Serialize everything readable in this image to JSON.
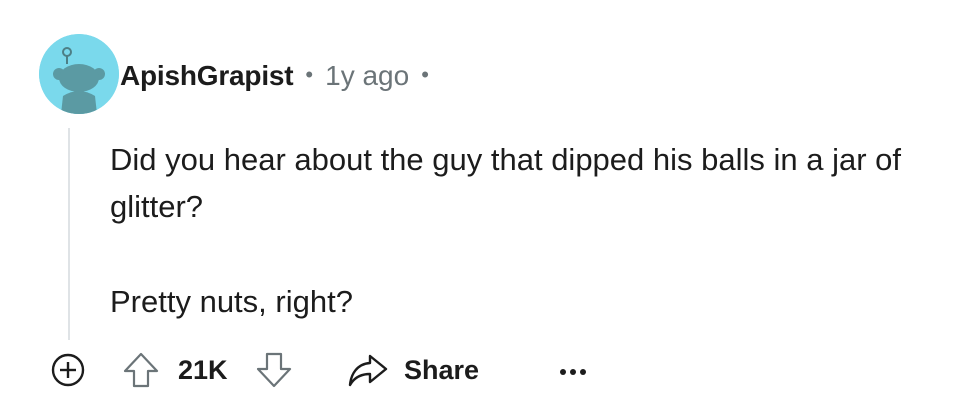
{
  "comment": {
    "username": "ApishGrapist",
    "separator": "•",
    "timestamp": "1y ago",
    "trailing_separator": "•",
    "avatar_icon": "snoo-avatar-icon",
    "avatar_color": "#7ad9ec",
    "paragraphs": [
      "Did you hear about the guy that dipped his balls in a jar of glitter?",
      "Pretty nuts, right?"
    ]
  },
  "actions": {
    "expand_icon": "plus-circle-icon",
    "upvote_icon": "arrow-up-icon",
    "vote_count": "21K",
    "downvote_icon": "arrow-down-icon",
    "share_icon": "share-arrow-icon",
    "share_label": "Share",
    "more_icon": "ellipsis-icon"
  },
  "colors": {
    "text": "#1c1c1c",
    "meta": "#6b7478",
    "thread_line": "#dfe3e6",
    "avatar_bg": "#7ad9ec"
  }
}
